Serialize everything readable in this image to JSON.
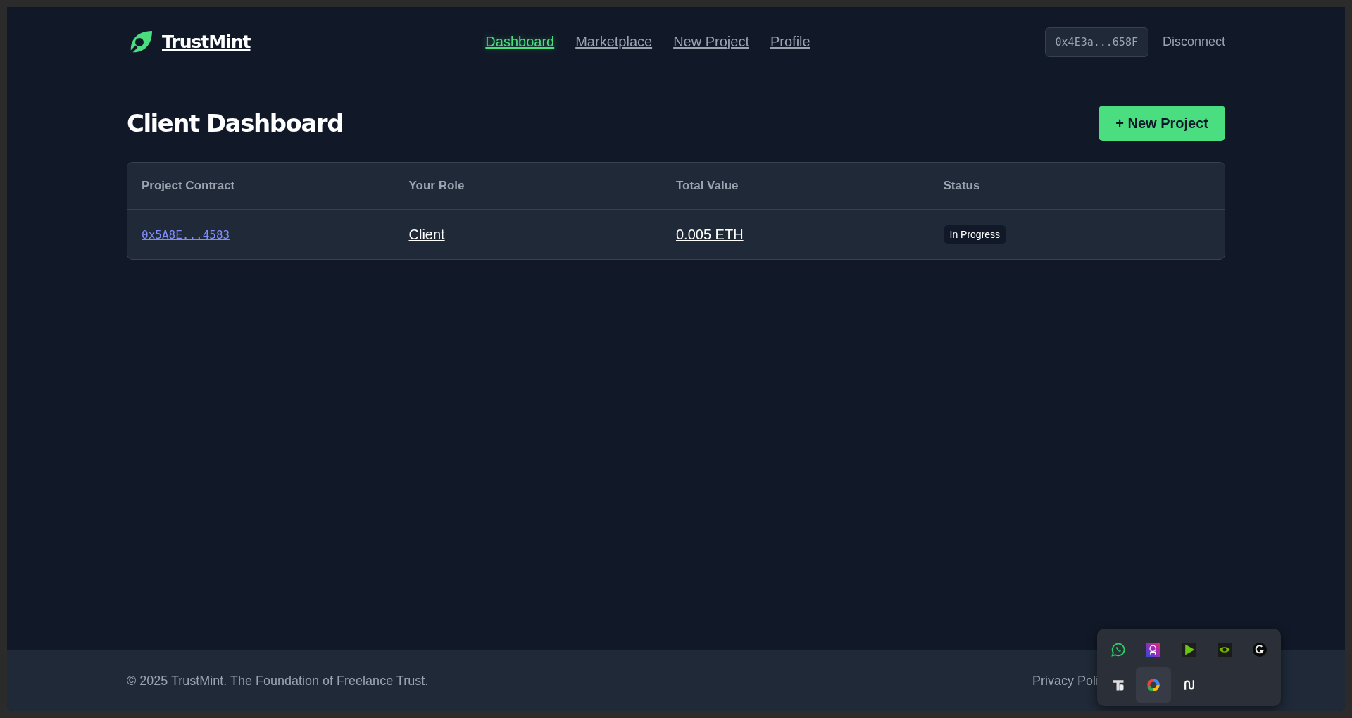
{
  "brand": {
    "name": "TrustMint"
  },
  "nav": [
    {
      "label": "Dashboard",
      "selected": true
    },
    {
      "label": "Marketplace",
      "selected": false
    },
    {
      "label": "New Project",
      "selected": false
    },
    {
      "label": "Profile",
      "selected": false
    }
  ],
  "wallet": {
    "address": "0x4E3a...658F",
    "disconnect": "Disconnect"
  },
  "page": {
    "title": "Client Dashboard",
    "action": "+ New Project"
  },
  "table": {
    "columns": [
      "Project Contract",
      "Your Role",
      "Total Value",
      "Status"
    ],
    "rows": [
      {
        "contract": "0x5A8E...4583",
        "role": "Client",
        "value": "0.005 ETH",
        "status": "In Progress"
      }
    ]
  },
  "footer": {
    "copyright": "© 2025 TrustMint. The Foundation of Freelance Trust.",
    "link": "Privacy Poli"
  },
  "tray": {
    "icons": [
      {
        "kind": "chat",
        "selected": false
      },
      {
        "kind": "camera",
        "selected": false
      },
      {
        "kind": "play",
        "selected": false
      },
      {
        "kind": "eye",
        "selected": false
      },
      {
        "kind": "g",
        "selected": false
      },
      {
        "kind": "tb",
        "selected": false
      },
      {
        "kind": "ring",
        "selected": true
      },
      {
        "kind": "wave",
        "selected": false
      }
    ]
  }
}
